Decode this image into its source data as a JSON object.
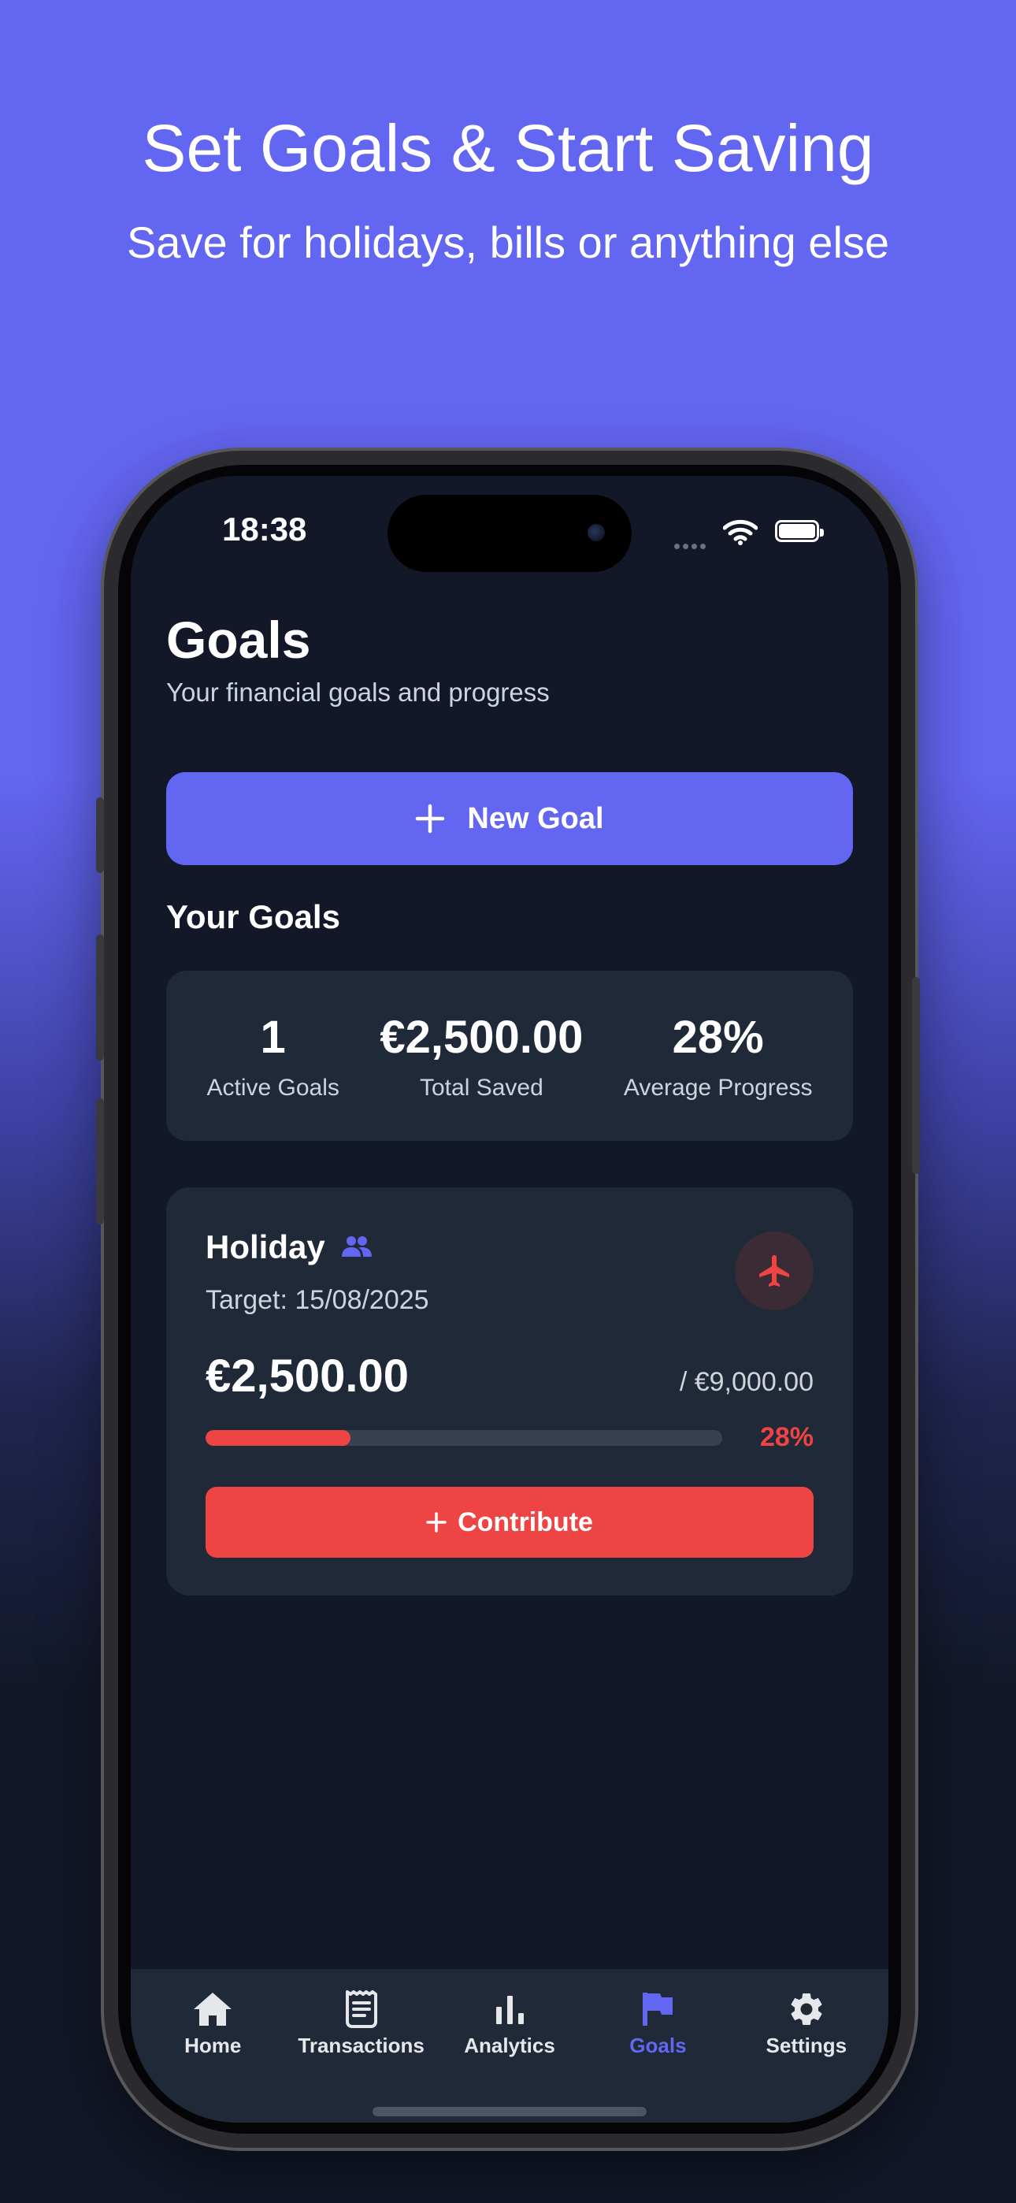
{
  "hero": {
    "title": "Set Goals & Start Saving",
    "subtitle": "Save for holidays, bills or anything else"
  },
  "status_bar": {
    "time": "18:38"
  },
  "header": {
    "title": "Goals",
    "subtitle": "Your financial goals and progress"
  },
  "new_goal_button": {
    "label": "New Goal",
    "icon": "plus-icon"
  },
  "section_title": "Your Goals",
  "stats": [
    {
      "value": "1",
      "label": "Active Goals"
    },
    {
      "value": "€2,500.00",
      "label": "Total Saved"
    },
    {
      "value": "28%",
      "label": "Average Progress"
    }
  ],
  "goal": {
    "name": "Holiday",
    "shared_icon": "people-icon",
    "target_label": "Target: 15/08/2025",
    "category_icon": "airplane-icon",
    "saved": "€2,500.00",
    "total": "/  €9,000.00",
    "progress_fraction": 0.28,
    "progress_label": "28%",
    "contribute_label": "Contribute"
  },
  "tabs": [
    {
      "label": "Home",
      "icon": "home-icon",
      "active": false
    },
    {
      "label": "Transactions",
      "icon": "receipt-icon",
      "active": false
    },
    {
      "label": "Analytics",
      "icon": "bar-chart-icon",
      "active": false
    },
    {
      "label": "Goals",
      "icon": "flag-icon",
      "active": true
    },
    {
      "label": "Settings",
      "icon": "gear-icon",
      "active": false
    }
  ],
  "colors": {
    "accent": "#6366f1",
    "danger": "#ef4444",
    "screen_bg": "#121827",
    "card_bg": "#1f2937"
  }
}
